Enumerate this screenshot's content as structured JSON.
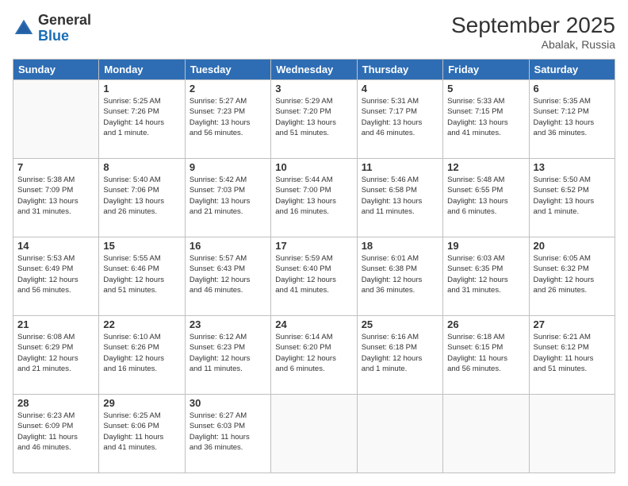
{
  "header": {
    "logo_general": "General",
    "logo_blue": "Blue",
    "month_title": "September 2025",
    "location": "Abalak, Russia"
  },
  "days_of_week": [
    "Sunday",
    "Monday",
    "Tuesday",
    "Wednesday",
    "Thursday",
    "Friday",
    "Saturday"
  ],
  "weeks": [
    [
      {
        "day": "",
        "info": ""
      },
      {
        "day": "1",
        "info": "Sunrise: 5:25 AM\nSunset: 7:26 PM\nDaylight: 14 hours\nand 1 minute."
      },
      {
        "day": "2",
        "info": "Sunrise: 5:27 AM\nSunset: 7:23 PM\nDaylight: 13 hours\nand 56 minutes."
      },
      {
        "day": "3",
        "info": "Sunrise: 5:29 AM\nSunset: 7:20 PM\nDaylight: 13 hours\nand 51 minutes."
      },
      {
        "day": "4",
        "info": "Sunrise: 5:31 AM\nSunset: 7:17 PM\nDaylight: 13 hours\nand 46 minutes."
      },
      {
        "day": "5",
        "info": "Sunrise: 5:33 AM\nSunset: 7:15 PM\nDaylight: 13 hours\nand 41 minutes."
      },
      {
        "day": "6",
        "info": "Sunrise: 5:35 AM\nSunset: 7:12 PM\nDaylight: 13 hours\nand 36 minutes."
      }
    ],
    [
      {
        "day": "7",
        "info": "Sunrise: 5:38 AM\nSunset: 7:09 PM\nDaylight: 13 hours\nand 31 minutes."
      },
      {
        "day": "8",
        "info": "Sunrise: 5:40 AM\nSunset: 7:06 PM\nDaylight: 13 hours\nand 26 minutes."
      },
      {
        "day": "9",
        "info": "Sunrise: 5:42 AM\nSunset: 7:03 PM\nDaylight: 13 hours\nand 21 minutes."
      },
      {
        "day": "10",
        "info": "Sunrise: 5:44 AM\nSunset: 7:00 PM\nDaylight: 13 hours\nand 16 minutes."
      },
      {
        "day": "11",
        "info": "Sunrise: 5:46 AM\nSunset: 6:58 PM\nDaylight: 13 hours\nand 11 minutes."
      },
      {
        "day": "12",
        "info": "Sunrise: 5:48 AM\nSunset: 6:55 PM\nDaylight: 13 hours\nand 6 minutes."
      },
      {
        "day": "13",
        "info": "Sunrise: 5:50 AM\nSunset: 6:52 PM\nDaylight: 13 hours\nand 1 minute."
      }
    ],
    [
      {
        "day": "14",
        "info": "Sunrise: 5:53 AM\nSunset: 6:49 PM\nDaylight: 12 hours\nand 56 minutes."
      },
      {
        "day": "15",
        "info": "Sunrise: 5:55 AM\nSunset: 6:46 PM\nDaylight: 12 hours\nand 51 minutes."
      },
      {
        "day": "16",
        "info": "Sunrise: 5:57 AM\nSunset: 6:43 PM\nDaylight: 12 hours\nand 46 minutes."
      },
      {
        "day": "17",
        "info": "Sunrise: 5:59 AM\nSunset: 6:40 PM\nDaylight: 12 hours\nand 41 minutes."
      },
      {
        "day": "18",
        "info": "Sunrise: 6:01 AM\nSunset: 6:38 PM\nDaylight: 12 hours\nand 36 minutes."
      },
      {
        "day": "19",
        "info": "Sunrise: 6:03 AM\nSunset: 6:35 PM\nDaylight: 12 hours\nand 31 minutes."
      },
      {
        "day": "20",
        "info": "Sunrise: 6:05 AM\nSunset: 6:32 PM\nDaylight: 12 hours\nand 26 minutes."
      }
    ],
    [
      {
        "day": "21",
        "info": "Sunrise: 6:08 AM\nSunset: 6:29 PM\nDaylight: 12 hours\nand 21 minutes."
      },
      {
        "day": "22",
        "info": "Sunrise: 6:10 AM\nSunset: 6:26 PM\nDaylight: 12 hours\nand 16 minutes."
      },
      {
        "day": "23",
        "info": "Sunrise: 6:12 AM\nSunset: 6:23 PM\nDaylight: 12 hours\nand 11 minutes."
      },
      {
        "day": "24",
        "info": "Sunrise: 6:14 AM\nSunset: 6:20 PM\nDaylight: 12 hours\nand 6 minutes."
      },
      {
        "day": "25",
        "info": "Sunrise: 6:16 AM\nSunset: 6:18 PM\nDaylight: 12 hours\nand 1 minute."
      },
      {
        "day": "26",
        "info": "Sunrise: 6:18 AM\nSunset: 6:15 PM\nDaylight: 11 hours\nand 56 minutes."
      },
      {
        "day": "27",
        "info": "Sunrise: 6:21 AM\nSunset: 6:12 PM\nDaylight: 11 hours\nand 51 minutes."
      }
    ],
    [
      {
        "day": "28",
        "info": "Sunrise: 6:23 AM\nSunset: 6:09 PM\nDaylight: 11 hours\nand 46 minutes."
      },
      {
        "day": "29",
        "info": "Sunrise: 6:25 AM\nSunset: 6:06 PM\nDaylight: 11 hours\nand 41 minutes."
      },
      {
        "day": "30",
        "info": "Sunrise: 6:27 AM\nSunset: 6:03 PM\nDaylight: 11 hours\nand 36 minutes."
      },
      {
        "day": "",
        "info": ""
      },
      {
        "day": "",
        "info": ""
      },
      {
        "day": "",
        "info": ""
      },
      {
        "day": "",
        "info": ""
      }
    ]
  ]
}
